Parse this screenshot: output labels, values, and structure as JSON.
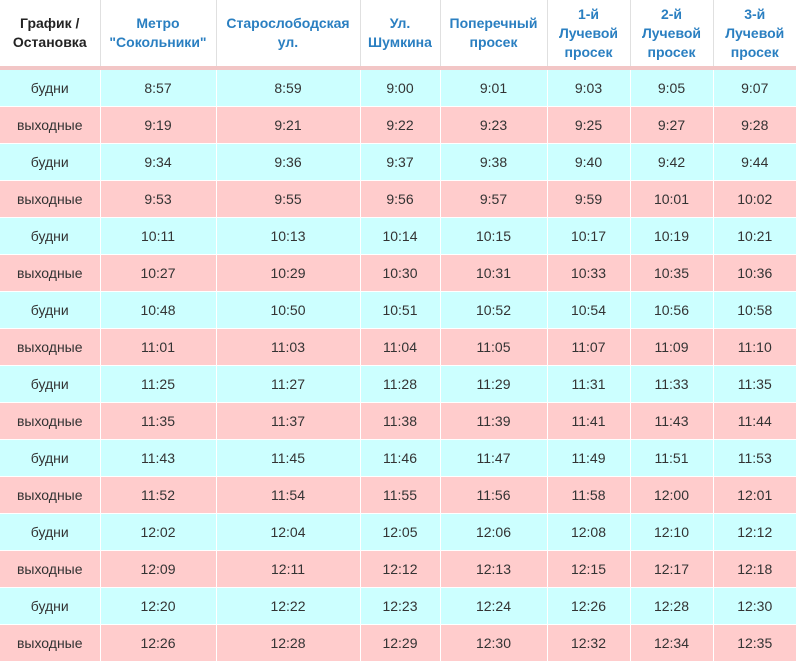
{
  "colors": {
    "header_text": "#2a7fc1",
    "weekday_row": "#ccffff",
    "weekend_row": "#ffcccc",
    "header_separator": "#f2c6c6"
  },
  "headers": [
    [
      "График /",
      "Остановка"
    ],
    [
      "Метро",
      "\"Сокольники\""
    ],
    [
      "Старослободская",
      "ул."
    ],
    [
      "Ул.",
      "Шумкина"
    ],
    [
      "Поперечный",
      "просек"
    ],
    [
      "1-й",
      "Лучевой",
      "просек"
    ],
    [
      "2-й",
      "Лучевой",
      "просек"
    ],
    [
      "3-й",
      "Лучевой",
      "просек"
    ]
  ],
  "rows": [
    {
      "type": "будни",
      "times": [
        "8:57",
        "8:59",
        "9:00",
        "9:01",
        "9:03",
        "9:05",
        "9:07"
      ]
    },
    {
      "type": "выходные",
      "times": [
        "9:19",
        "9:21",
        "9:22",
        "9:23",
        "9:25",
        "9:27",
        "9:28"
      ]
    },
    {
      "type": "будни",
      "times": [
        "9:34",
        "9:36",
        "9:37",
        "9:38",
        "9:40",
        "9:42",
        "9:44"
      ]
    },
    {
      "type": "выходные",
      "times": [
        "9:53",
        "9:55",
        "9:56",
        "9:57",
        "9:59",
        "10:01",
        "10:02"
      ]
    },
    {
      "type": "будни",
      "times": [
        "10:11",
        "10:13",
        "10:14",
        "10:15",
        "10:17",
        "10:19",
        "10:21"
      ]
    },
    {
      "type": "выходные",
      "times": [
        "10:27",
        "10:29",
        "10:30",
        "10:31",
        "10:33",
        "10:35",
        "10:36"
      ]
    },
    {
      "type": "будни",
      "times": [
        "10:48",
        "10:50",
        "10:51",
        "10:52",
        "10:54",
        "10:56",
        "10:58"
      ]
    },
    {
      "type": "выходные",
      "times": [
        "11:01",
        "11:03",
        "11:04",
        "11:05",
        "11:07",
        "11:09",
        "11:10"
      ]
    },
    {
      "type": "будни",
      "times": [
        "11:25",
        "11:27",
        "11:28",
        "11:29",
        "11:31",
        "11:33",
        "11:35"
      ]
    },
    {
      "type": "выходные",
      "times": [
        "11:35",
        "11:37",
        "11:38",
        "11:39",
        "11:41",
        "11:43",
        "11:44"
      ]
    },
    {
      "type": "будни",
      "times": [
        "11:43",
        "11:45",
        "11:46",
        "11:47",
        "11:49",
        "11:51",
        "11:53"
      ]
    },
    {
      "type": "выходные",
      "times": [
        "11:52",
        "11:54",
        "11:55",
        "11:56",
        "11:58",
        "12:00",
        "12:01"
      ]
    },
    {
      "type": "будни",
      "times": [
        "12:02",
        "12:04",
        "12:05",
        "12:06",
        "12:08",
        "12:10",
        "12:12"
      ]
    },
    {
      "type": "выходные",
      "times": [
        "12:09",
        "12:11",
        "12:12",
        "12:13",
        "12:15",
        "12:17",
        "12:18"
      ]
    },
    {
      "type": "будни",
      "times": [
        "12:20",
        "12:22",
        "12:23",
        "12:24",
        "12:26",
        "12:28",
        "12:30"
      ]
    },
    {
      "type": "выходные",
      "times": [
        "12:26",
        "12:28",
        "12:29",
        "12:30",
        "12:32",
        "12:34",
        "12:35"
      ]
    }
  ]
}
